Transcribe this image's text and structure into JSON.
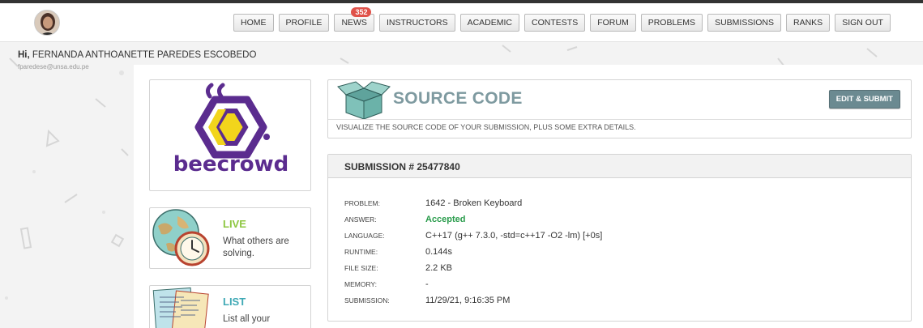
{
  "nav": {
    "items": [
      {
        "label": "HOME"
      },
      {
        "label": "PROFILE"
      },
      {
        "label": "NEWS",
        "badge": "352"
      },
      {
        "label": "INSTRUCTORS"
      },
      {
        "label": "ACADEMIC"
      },
      {
        "label": "CONTESTS"
      },
      {
        "label": "FORUM"
      },
      {
        "label": "PROBLEMS"
      },
      {
        "label": "SUBMISSIONS"
      },
      {
        "label": "RANKS"
      },
      {
        "label": "SIGN OUT"
      }
    ]
  },
  "user": {
    "greeting": "Hi,",
    "name": "FERNANDA ANTHOANETTE PAREDES ESCOBEDO",
    "email": "fparedese@unsa.edu.pe"
  },
  "logo": {
    "text": "beecrowd",
    "color": "#5b2c8f",
    "accent": "#f2d51c"
  },
  "sidebar": {
    "live": {
      "title": "LIVE",
      "desc": "What others are solving.",
      "color": "#8cc63f"
    },
    "list": {
      "title": "LIST",
      "desc": "List all your",
      "color": "#3fa9b5"
    }
  },
  "page": {
    "title": "SOURCE CODE",
    "subtitle": "VISUALIZE THE SOURCE CODE OF YOUR SUBMISSION, PLUS SOME EXTRA DETAILS.",
    "edit_button": "EDIT & SUBMIT"
  },
  "submission": {
    "header": "SUBMISSION # 25477840",
    "fields": [
      {
        "label": "PROBLEM:",
        "value": "1642 - Broken Keyboard"
      },
      {
        "label": "ANSWER:",
        "value": "Accepted"
      },
      {
        "label": "LANGUAGE:",
        "value": "C++17 (g++ 7.3.0, -std=c++17 -O2 -lm) [+0s]"
      },
      {
        "label": "RUNTIME:",
        "value": "0.144s"
      },
      {
        "label": "FILE SIZE:",
        "value": "2.2 KB"
      },
      {
        "label": "MEMORY:",
        "value": "-"
      },
      {
        "label": "SUBMISSION:",
        "value": "11/29/21, 9:16:35 PM"
      }
    ]
  },
  "colors": {
    "accepted": "#2a9c4c",
    "title": "#7e9aa0",
    "badge": "#e0524a"
  }
}
